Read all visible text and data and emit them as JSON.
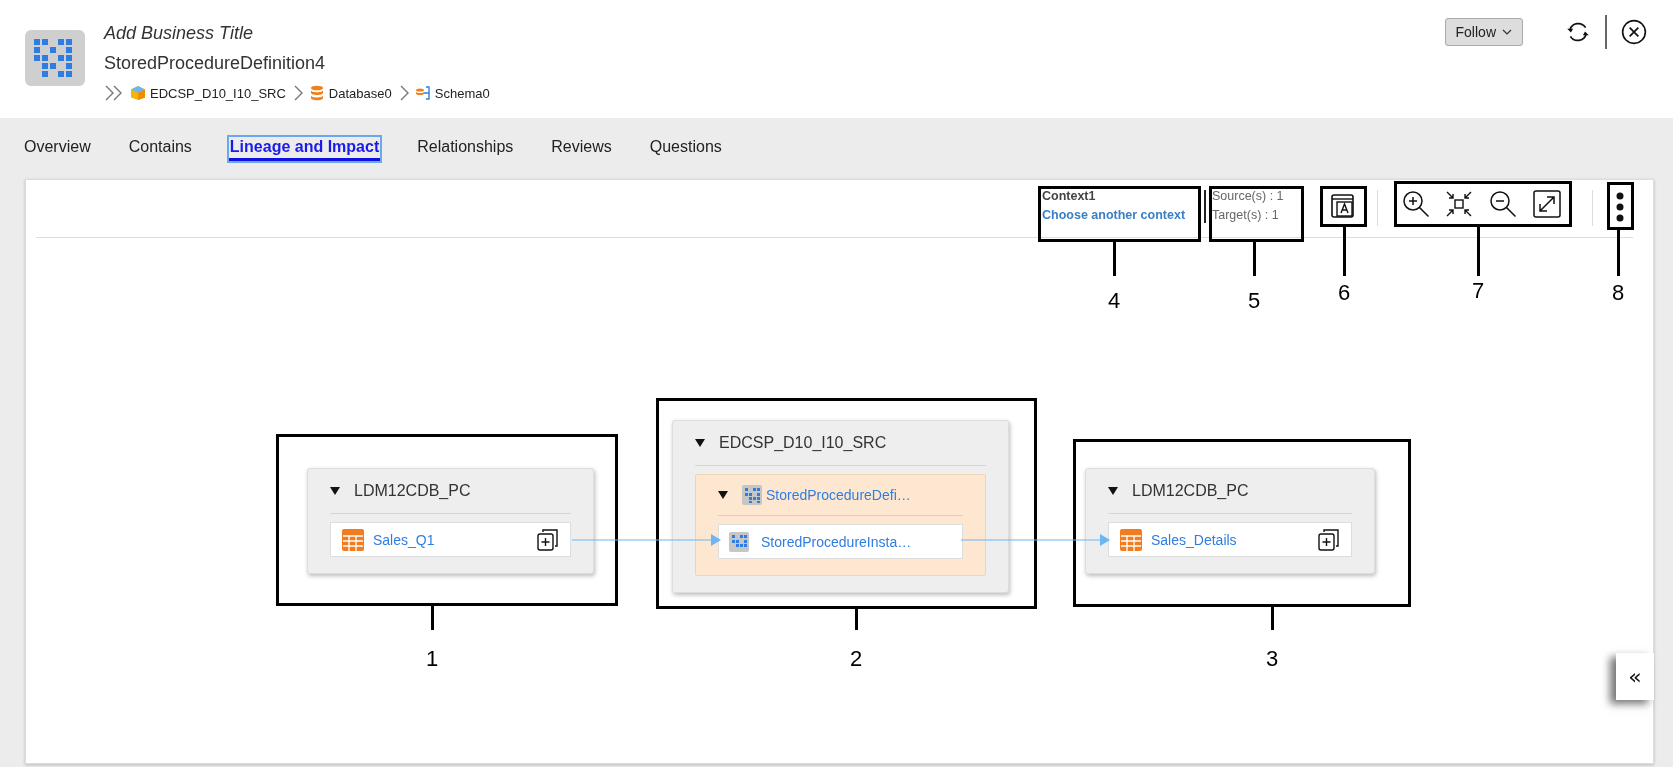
{
  "header": {
    "business_title": "Add Business Title",
    "name": "StoredProcedureDefinition4",
    "breadcrumb": [
      {
        "kind": "resource",
        "label": "EDCSP_D10_I10_SRC"
      },
      {
        "kind": "database",
        "label": "Database0"
      },
      {
        "kind": "schema",
        "label": "Schema0"
      }
    ],
    "follow_button": "Follow"
  },
  "tabs": [
    {
      "label": "Overview",
      "selected": false
    },
    {
      "label": "Contains",
      "selected": false
    },
    {
      "label": "Lineage and Impact",
      "selected": true
    },
    {
      "label": "Relationships",
      "selected": false
    },
    {
      "label": "Reviews",
      "selected": false
    },
    {
      "label": "Questions",
      "selected": false
    }
  ],
  "toolbar": {
    "context_name": "Context1",
    "context_link": "Choose another context",
    "sources": "Source(s) : 1",
    "targets": "Target(s) : 1"
  },
  "lineage": {
    "nodes": [
      {
        "title": "LDM12CDB_PC",
        "expanded": true,
        "children": [
          {
            "kind": "table",
            "label": "Sales_Q1"
          }
        ]
      },
      {
        "title": "EDCSP_D10_I10_SRC",
        "expanded": true,
        "children": [
          {
            "kind": "procedure",
            "label": "StoredProcedureDefi…",
            "expanded": true,
            "children": [
              {
                "kind": "procedure",
                "label": "StoredProcedureInsta…"
              }
            ]
          }
        ]
      },
      {
        "title": "LDM12CDB_PC",
        "expanded": true,
        "children": [
          {
            "kind": "table",
            "label": "Sales_Details"
          }
        ]
      }
    ]
  },
  "callouts": [
    "1",
    "2",
    "3",
    "4",
    "5",
    "6",
    "7",
    "8"
  ],
  "collapse_button": "«"
}
